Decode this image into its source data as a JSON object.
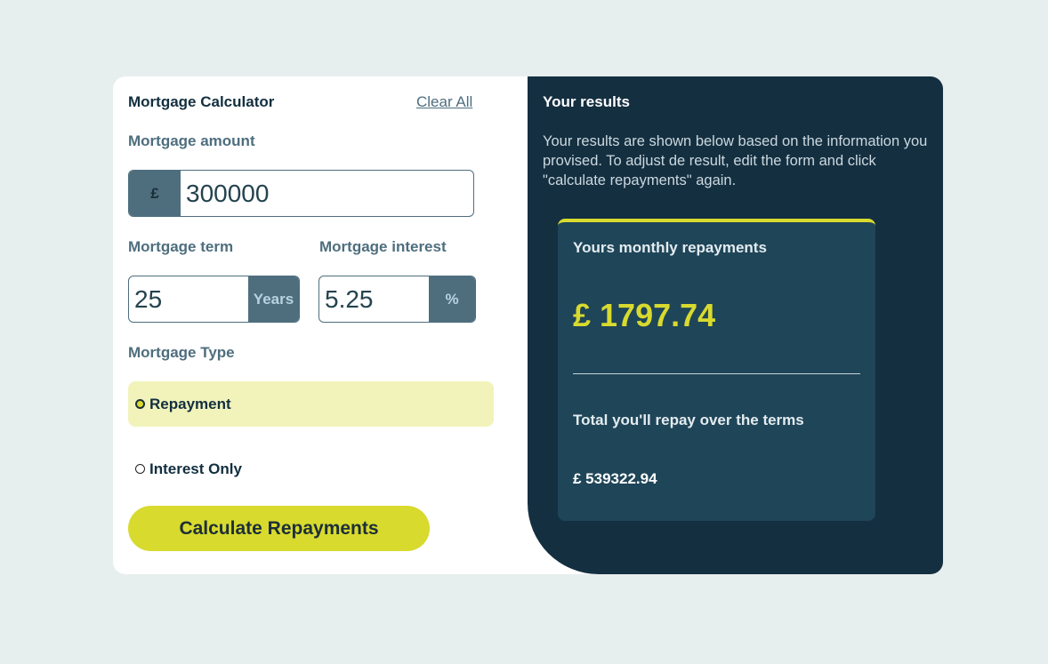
{
  "calculator": {
    "title": "Mortgage Calculator",
    "clear_all": "Clear All",
    "amount_label": "Mortgage amount",
    "amount_prefix": "£",
    "amount_value": "300000",
    "term_label": "Mortgage term",
    "term_value": "25",
    "term_suffix": "Years",
    "interest_label": "Mortgage interest",
    "interest_value": "5.25",
    "interest_suffix": "%",
    "type_label": "Mortgage Type",
    "type_options": [
      {
        "label": "Repayment",
        "selected": true
      },
      {
        "label": "Interest Only",
        "selected": false
      }
    ],
    "calculate_button": "Calculate Repayments"
  },
  "results": {
    "title": "Your results",
    "description": "Your results are shown below based on the information you provised. To adjust de result, edit the form and click \"calculate repayments\" again.",
    "monthly_label": "Yours monthly repayments",
    "monthly_value": "£ 1797.74",
    "total_label": "Total you'll repay over the terms",
    "total_value": "£ 539322.94"
  },
  "colors": {
    "accent_lime": "#d8da2e",
    "panel_dark": "#142f40",
    "slate": "#4e6e7e"
  }
}
